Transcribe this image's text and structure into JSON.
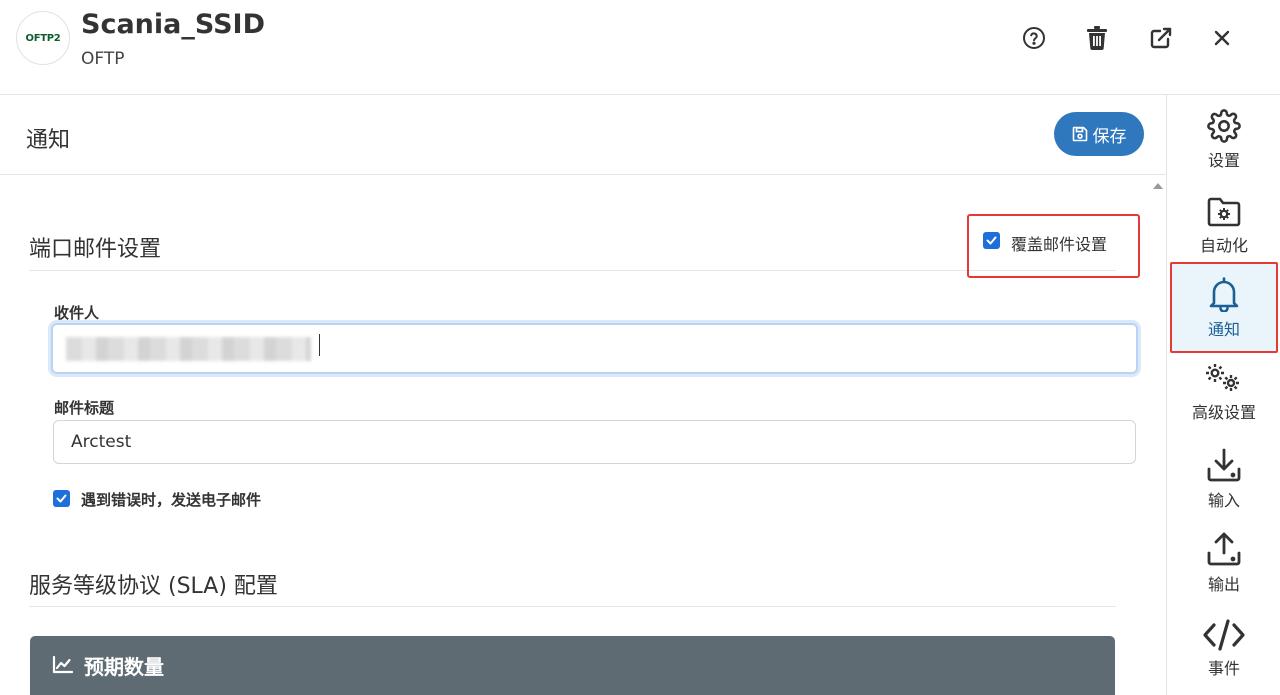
{
  "header": {
    "logo_text": "OFTP2",
    "title": "Scania_SSID",
    "subtitle": "OFTP"
  },
  "panel": {
    "title": "通知",
    "save_label": "保存"
  },
  "port_mail": {
    "section_title": "端口邮件设置",
    "override_label": "覆盖邮件设置",
    "override_checked": true,
    "recipient_label": "收件人",
    "recipient_value": "",
    "subject_label": "邮件标题",
    "subject_value": "Arctest",
    "send_on_error_label": "遇到错误时，发送电子邮件",
    "send_on_error_checked": true
  },
  "sla": {
    "section_title": "服务等级协议 (SLA) 配置",
    "card_title": "预期数量"
  },
  "sidebar": {
    "items": [
      {
        "label": "设置",
        "icon": "gear-icon"
      },
      {
        "label": "自动化",
        "icon": "folder-gear-icon"
      },
      {
        "label": "通知",
        "icon": "bell-icon",
        "active": true
      },
      {
        "label": "高级设置",
        "icon": "gears-icon"
      },
      {
        "label": "输入",
        "icon": "download-icon"
      },
      {
        "label": "输出",
        "icon": "upload-icon"
      },
      {
        "label": "事件",
        "icon": "code-icon"
      }
    ]
  },
  "colors": {
    "primary": "#2f78bd",
    "checkbox": "#1e6fd9",
    "highlight": "#e53935",
    "card_header": "#5f6b72",
    "active_nav_text": "#1a5f95"
  }
}
